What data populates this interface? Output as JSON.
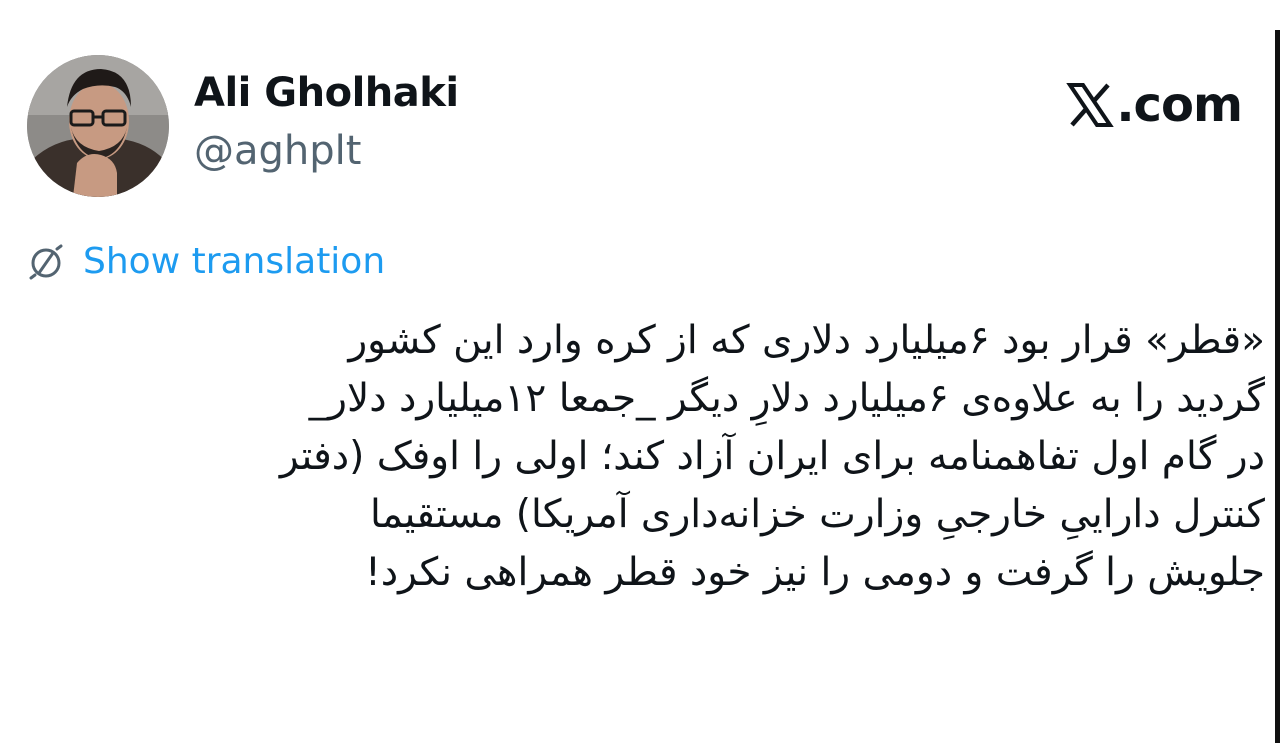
{
  "author": {
    "display_name": "Ali Gholhaki",
    "handle": "@aghplt",
    "avatar_icon": "profile-photo"
  },
  "brand": {
    "icon": "x-logo",
    "text": ".com"
  },
  "translation": {
    "icon": "globe-icon",
    "label": "Show translation",
    "color": "#1d9bf0"
  },
  "tweet": {
    "lines": [
      "«قطر» قرار بود ۶میلیارد دلاری که از کره وارد این کشور",
      "گردید را به علاوه‌ی ۶میلیارد دلارِ دیگر _جمعا ۱۲میلیارد دلار_",
      "در گام اول تفاهمنامه برای ایران آزاد کند؛ اولی را اوفک (دفتر",
      "کنترل داراییِ خارجیِ وزارت خزانه‌داری آمریکا) مستقیما",
      "جلویش را گرفت و دومی را نیز خود قطر همراهی نکرد!"
    ]
  }
}
